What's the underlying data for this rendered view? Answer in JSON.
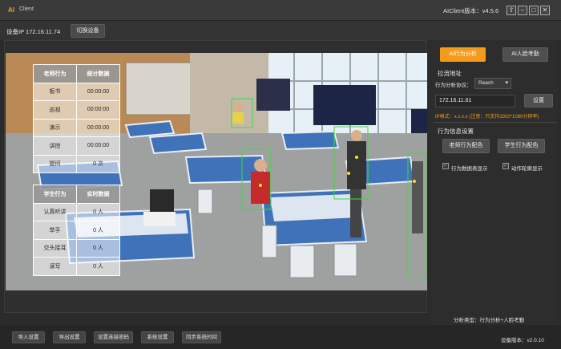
{
  "titlebar": {
    "logo": "AI",
    "app_name": "Client",
    "version": "AIClient版本：v4.5.6",
    "buttons": [
      "⇪",
      "–",
      "□",
      "✕"
    ]
  },
  "device": {
    "ip_label": "设备IP  172.16.11.74",
    "switch_button": "切换设备"
  },
  "teacher_table": {
    "headers": [
      "老师行为",
      "统计数据"
    ],
    "rows": [
      [
        "板书",
        "00:00:00"
      ],
      [
        "巡视",
        "00:00:00"
      ],
      [
        "演示",
        "00:00:00"
      ],
      [
        "讲授",
        "00:00:00"
      ],
      [
        "提问",
        "0 次"
      ]
    ]
  },
  "student_table": {
    "headers": [
      "学生行为",
      "实时数据"
    ],
    "rows": [
      [
        "认真听讲",
        "0 人"
      ],
      [
        "举手",
        "0 人"
      ],
      [
        "交头接耳",
        "0 人"
      ],
      [
        "读写",
        "0 人"
      ]
    ]
  },
  "right": {
    "tab_behavior": "AI行为分析",
    "tab_face": "AI人脸考勤",
    "stream_title": "拉流地址",
    "protocol_label": "行为分析协议：",
    "protocol_value": "Reach",
    "stream_ip": "172.16.11.61",
    "set_button": "设置",
    "hint": "IP格式：x.x.x.x (注意：只支持1920*1080分辨率)",
    "behavior_title": "行为信息设置",
    "teacher_color_button": "老师行为配色",
    "student_color_button": "学生行为配色",
    "check_data": "行为数据表显示",
    "check_outline": "动作轮廓显示",
    "analysis_type": "分析类型：行为分析+人脸考勤",
    "device_version": "设备版本：v2.0.10"
  },
  "bottom_buttons": [
    "导入设置",
    "导出设置",
    "设置连接密码",
    "系统设置",
    "同步系统时间"
  ],
  "colors": {
    "accent": "#f29b1d",
    "detection_box": "#3ddc3d"
  }
}
